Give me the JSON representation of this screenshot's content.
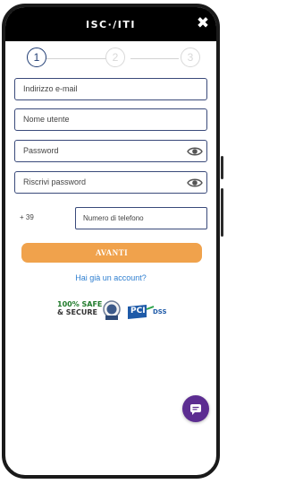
{
  "header": {
    "title": "ISC·/ITI",
    "close_icon": "✖"
  },
  "steps": [
    {
      "label": "1",
      "state": "active"
    },
    {
      "label": "2",
      "state": "inactive"
    },
    {
      "label": "3",
      "state": "inactive"
    }
  ],
  "form": {
    "email_placeholder": "Indirizzo e-mail",
    "username_placeholder": "Nome utente",
    "password_placeholder": "Password",
    "repeat_password_placeholder": "Riscrivi password",
    "phone_prefix": "+ 39",
    "phone_placeholder": "Numero di telefono"
  },
  "actions": {
    "next_label": "AVANTI",
    "account_link": "Hai già un account?"
  },
  "badges": {
    "safe_line1": "100% SAFE",
    "safe_line2": "& SECURE",
    "pci_label": "PCI",
    "pci_sub": "DSS"
  },
  "colors": {
    "header_bg": "#000000",
    "field_border": "#3a4a7a",
    "button_bg": "#f0a24c",
    "link": "#2f7fd0",
    "chat_fab": "#5c2d91"
  },
  "icons": {
    "close": "close-icon",
    "eye": "eye-icon",
    "chat": "chat-icon"
  }
}
